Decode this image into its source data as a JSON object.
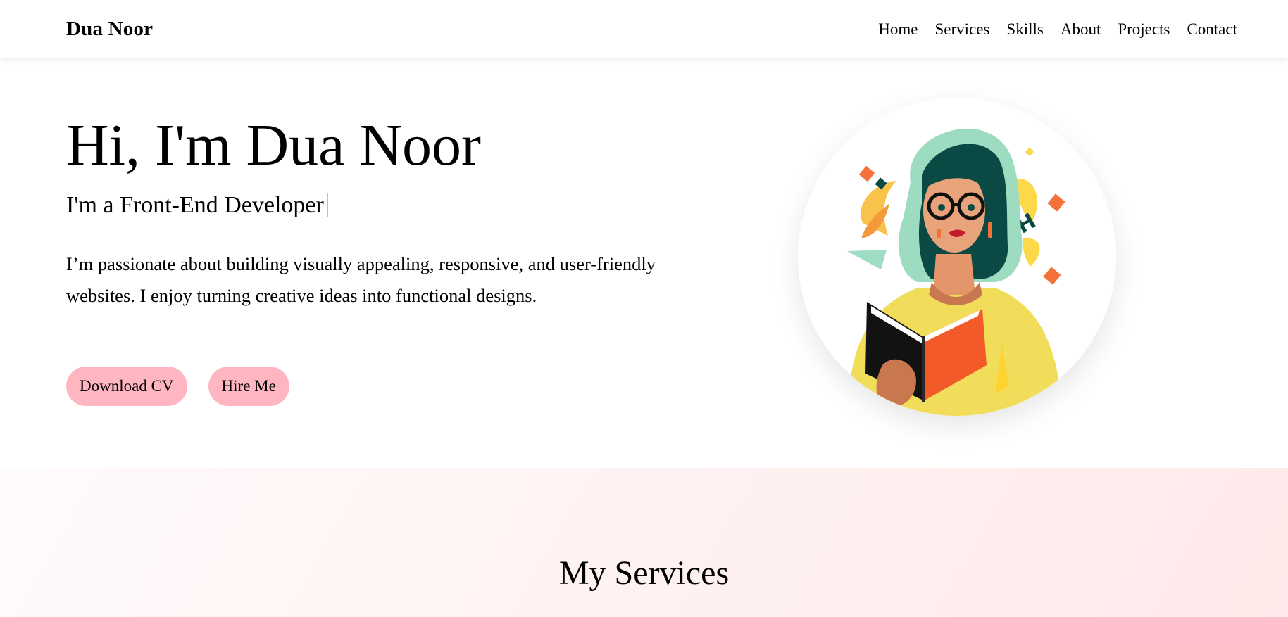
{
  "navbar": {
    "logo": "Dua Noor",
    "links": [
      "Home",
      "Services",
      "Skills",
      "About",
      "Projects",
      "Contact"
    ]
  },
  "hero": {
    "title": "Hi, I'm Dua Noor",
    "subtitle": "I'm a Front-End Developer",
    "description": "I’m passionate about building visually appealing, responsive, and user-friendly websites. I enjoy turning creative ideas into functional designs.",
    "buttons": {
      "download": "Download CV",
      "hire": "Hire Me"
    },
    "avatar_icon": "woman-reading-book-illustration"
  },
  "services": {
    "title": "My Services"
  },
  "colors": {
    "button_bg": "#ffb6c1",
    "cursor": "#ff9ecb",
    "services_bg": "#fff0f0"
  }
}
